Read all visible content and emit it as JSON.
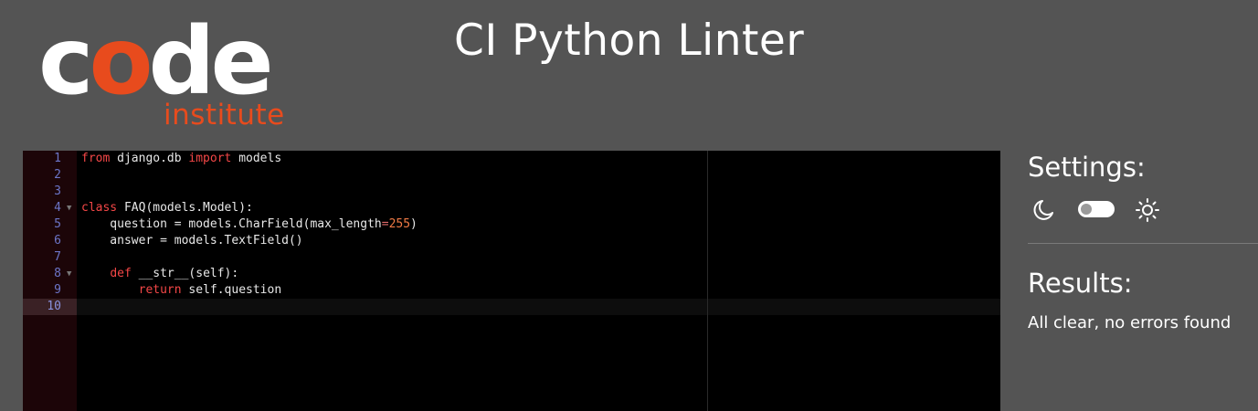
{
  "logo": {
    "word_pre": "c",
    "word_accent": "o",
    "word_post": "de",
    "sub": "institute",
    "accent_color": "#e84b1d"
  },
  "header": {
    "title": "CI Python Linter"
  },
  "editor": {
    "line_numbers": [
      "1",
      "2",
      "3",
      "4",
      "5",
      "6",
      "7",
      "8",
      "9",
      "10"
    ],
    "fold_markers": {
      "4": "▼",
      "8": "▼"
    },
    "active_line": 10,
    "lines": [
      "from django.db import models",
      "",
      "",
      "class FAQ(models.Model):",
      "    question = models.CharField(max_length=255)",
      "    answer = models.TextField()",
      "",
      "    def __str__(self):",
      "        return self.question",
      ""
    ]
  },
  "settings": {
    "title": "Settings:",
    "dark_icon": "moon-icon",
    "light_icon": "sun-icon",
    "toggle_state": "dark"
  },
  "results": {
    "title": "Results:",
    "message": "All clear, no errors found"
  }
}
